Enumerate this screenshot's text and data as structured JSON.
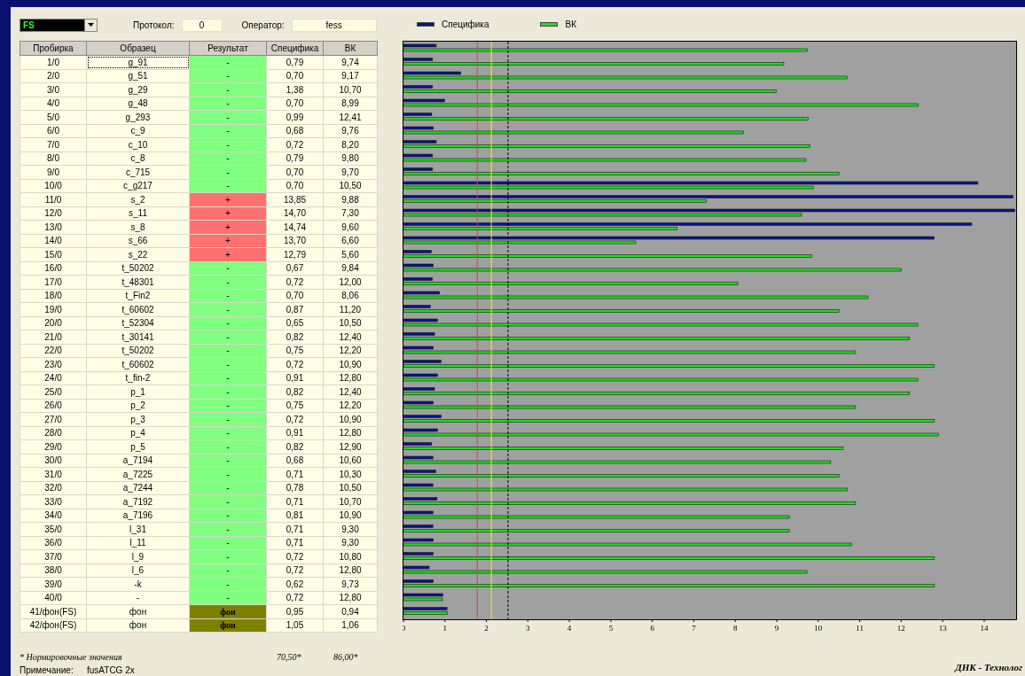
{
  "toolbar": {
    "selector": {
      "value": "FS"
    },
    "protocol": {
      "label": "Протокол:",
      "value": "0"
    },
    "operator": {
      "label": "Оператор:",
      "value": "fess"
    }
  },
  "table": {
    "columns": [
      "Пробирка",
      "Образец",
      "Результат",
      "Специфика",
      "ВК"
    ],
    "rows": [
      {
        "tube": "1/0",
        "sample": "g_91",
        "result": "-",
        "kind": "negative",
        "spec": "0,79",
        "vk": "9,74",
        "focused": true
      },
      {
        "tube": "2/0",
        "sample": "g_51",
        "result": "-",
        "kind": "negative",
        "spec": "0,70",
        "vk": "9,17",
        "focused": false
      },
      {
        "tube": "3/0",
        "sample": "g_29",
        "result": "-",
        "kind": "negative",
        "spec": "1,38",
        "vk": "10,70",
        "focused": false
      },
      {
        "tube": "4/0",
        "sample": "g_48",
        "result": "-",
        "kind": "negative",
        "spec": "0,70",
        "vk": "8,99",
        "focused": false
      },
      {
        "tube": "5/0",
        "sample": "g_293",
        "result": "-",
        "kind": "negative",
        "spec": "0,99",
        "vk": "12,41",
        "focused": false
      },
      {
        "tube": "6/0",
        "sample": "c_9",
        "result": "-",
        "kind": "negative",
        "spec": "0,68",
        "vk": "9,76",
        "focused": false
      },
      {
        "tube": "7/0",
        "sample": "c_10",
        "result": "-",
        "kind": "negative",
        "spec": "0,72",
        "vk": "8,20",
        "focused": false
      },
      {
        "tube": "8/0",
        "sample": "c_8",
        "result": "-",
        "kind": "negative",
        "spec": "0,79",
        "vk": "9,80",
        "focused": false
      },
      {
        "tube": "9/0",
        "sample": "c_715",
        "result": "-",
        "kind": "negative",
        "spec": "0,70",
        "vk": "9,70",
        "focused": false
      },
      {
        "tube": "10/0",
        "sample": "c_g217",
        "result": "-",
        "kind": "negative",
        "spec": "0,70",
        "vk": "10,50",
        "focused": false
      },
      {
        "tube": "11/0",
        "sample": "s_2",
        "result": "+",
        "kind": "positive",
        "spec": "13,85",
        "vk": "9,88",
        "focused": false
      },
      {
        "tube": "12/0",
        "sample": "s_11",
        "result": "+",
        "kind": "positive",
        "spec": "14,70",
        "vk": "7,30",
        "focused": false
      },
      {
        "tube": "13/0",
        "sample": "s_8",
        "result": "+",
        "kind": "positive",
        "spec": "14,74",
        "vk": "9,60",
        "focused": false
      },
      {
        "tube": "14/0",
        "sample": "s_66",
        "result": "+",
        "kind": "positive",
        "spec": "13,70",
        "vk": "6,60",
        "focused": false
      },
      {
        "tube": "15/0",
        "sample": "s_22",
        "result": "+",
        "kind": "positive",
        "spec": "12,79",
        "vk": "5,60",
        "focused": false
      },
      {
        "tube": "16/0",
        "sample": "t_50202",
        "result": "-",
        "kind": "negative",
        "spec": "0,67",
        "vk": "9,84",
        "focused": false
      },
      {
        "tube": "17/0",
        "sample": "t_48301",
        "result": "-",
        "kind": "negative",
        "spec": "0,72",
        "vk": "12,00",
        "focused": false
      },
      {
        "tube": "18/0",
        "sample": "t_Fin2",
        "result": "-",
        "kind": "negative",
        "spec": "0,70",
        "vk": "8,06",
        "focused": false
      },
      {
        "tube": "19/0",
        "sample": "t_60602",
        "result": "-",
        "kind": "negative",
        "spec": "0,87",
        "vk": "11,20",
        "focused": false
      },
      {
        "tube": "20/0",
        "sample": "t_52304",
        "result": "-",
        "kind": "negative",
        "spec": "0,65",
        "vk": "10,50",
        "focused": false
      },
      {
        "tube": "21/0",
        "sample": "t_30141",
        "result": "-",
        "kind": "negative",
        "spec": "0,82",
        "vk": "12,40",
        "focused": false
      },
      {
        "tube": "22/0",
        "sample": "t_50202",
        "result": "-",
        "kind": "negative",
        "spec": "0,75",
        "vk": "12,20",
        "focused": false
      },
      {
        "tube": "23/0",
        "sample": "t_60602",
        "result": "-",
        "kind": "negative",
        "spec": "0,72",
        "vk": "10,90",
        "focused": false
      },
      {
        "tube": "24/0",
        "sample": "t_fin-2",
        "result": "-",
        "kind": "negative",
        "spec": "0,91",
        "vk": "12,80",
        "focused": false
      },
      {
        "tube": "25/0",
        "sample": "p_1",
        "result": "-",
        "kind": "negative",
        "spec": "0,82",
        "vk": "12,40",
        "focused": false
      },
      {
        "tube": "26/0",
        "sample": "p_2",
        "result": "-",
        "kind": "negative",
        "spec": "0,75",
        "vk": "12,20",
        "focused": false
      },
      {
        "tube": "27/0",
        "sample": "p_3",
        "result": "-",
        "kind": "negative",
        "spec": "0,72",
        "vk": "10,90",
        "focused": false
      },
      {
        "tube": "28/0",
        "sample": "p_4",
        "result": "-",
        "kind": "negative",
        "spec": "0,91",
        "vk": "12,80",
        "focused": false
      },
      {
        "tube": "29/0",
        "sample": "p_5",
        "result": "-",
        "kind": "negative",
        "spec": "0,82",
        "vk": "12,90",
        "focused": false
      },
      {
        "tube": "30/0",
        "sample": "a_7194",
        "result": "-",
        "kind": "negative",
        "spec": "0,68",
        "vk": "10,60",
        "focused": false
      },
      {
        "tube": "31/0",
        "sample": "a_7225",
        "result": "-",
        "kind": "negative",
        "spec": "0,71",
        "vk": "10,30",
        "focused": false
      },
      {
        "tube": "32/0",
        "sample": "a_7244",
        "result": "-",
        "kind": "negative",
        "spec": "0,78",
        "vk": "10,50",
        "focused": false
      },
      {
        "tube": "33/0",
        "sample": "a_7192",
        "result": "-",
        "kind": "negative",
        "spec": "0,71",
        "vk": "10,70",
        "focused": false
      },
      {
        "tube": "34/0",
        "sample": "a_7196",
        "result": "-",
        "kind": "negative",
        "spec": "0,81",
        "vk": "10,90",
        "focused": false
      },
      {
        "tube": "35/0",
        "sample": "l_31",
        "result": "-",
        "kind": "negative",
        "spec": "0,71",
        "vk": "9,30",
        "focused": false
      },
      {
        "tube": "36/0",
        "sample": "l_11",
        "result": "-",
        "kind": "negative",
        "spec": "0,71",
        "vk": "9,30",
        "focused": false
      },
      {
        "tube": "37/0",
        "sample": "l_9",
        "result": "-",
        "kind": "negative",
        "spec": "0,72",
        "vk": "10,80",
        "focused": false
      },
      {
        "tube": "38/0",
        "sample": "l_6",
        "result": "-",
        "kind": "negative",
        "spec": "0,72",
        "vk": "12,80",
        "focused": false
      },
      {
        "tube": "39/0",
        "sample": "-k",
        "result": "-",
        "kind": "negative",
        "spec": "0,62",
        "vk": "9,73",
        "focused": false
      },
      {
        "tube": "40/0",
        "sample": "-",
        "result": "-",
        "kind": "negative",
        "spec": "0,72",
        "vk": "12,80",
        "focused": false
      },
      {
        "tube": "41/фон(FS)",
        "sample": "фон",
        "result": "фон",
        "kind": "background",
        "spec": "0,95",
        "vk": "0,94",
        "focused": false
      },
      {
        "tube": "42/фон(FS)",
        "sample": "фон",
        "result": "фон",
        "kind": "background",
        "spec": "1,05",
        "vk": "1,06",
        "focused": false
      }
    ]
  },
  "footnote": {
    "text": "* Нормировочные значения",
    "spec": "70,50*",
    "vk": "86,00*"
  },
  "note": {
    "label": "Примечание:",
    "value": "fusATCG 2x"
  },
  "brand": "ДНК - Технолог",
  "chart": {
    "chart_data": {
      "type": "bar",
      "orientation": "horizontal",
      "xlim": [
        0,
        14.75
      ],
      "xticks": [
        0,
        1,
        2,
        3,
        4,
        5,
        6,
        7,
        8,
        9,
        10,
        11,
        12,
        13,
        14
      ],
      "series": [
        {
          "name": "Специфика",
          "color": "#0a148c",
          "values": [
            0.79,
            0.7,
            1.38,
            0.7,
            0.99,
            0.68,
            0.72,
            0.79,
            0.7,
            0.7,
            13.85,
            14.7,
            14.74,
            13.7,
            12.79,
            0.67,
            0.72,
            0.7,
            0.87,
            0.65,
            0.82,
            0.75,
            0.72,
            0.91,
            0.82,
            0.75,
            0.72,
            0.91,
            0.82,
            0.68,
            0.71,
            0.78,
            0.71,
            0.81,
            0.71,
            0.71,
            0.72,
            0.72,
            0.62,
            0.72,
            0.95,
            1.05
          ]
        },
        {
          "name": "ВК",
          "color": "#22dd22",
          "values": [
            9.74,
            9.17,
            10.7,
            8.99,
            12.41,
            9.76,
            8.2,
            9.8,
            9.7,
            10.5,
            9.88,
            7.3,
            9.6,
            6.6,
            5.6,
            9.84,
            12.0,
            8.06,
            11.2,
            10.5,
            12.4,
            12.2,
            10.9,
            12.8,
            12.4,
            12.2,
            10.9,
            12.8,
            12.9,
            10.6,
            10.3,
            10.5,
            10.7,
            10.9,
            9.3,
            9.3,
            10.8,
            12.8,
            9.73,
            12.8,
            0.94,
            1.06
          ]
        }
      ],
      "ref_lines": [
        {
          "axis": "x",
          "value": 1.78
        },
        {
          "axis": "x",
          "value": 2.12
        },
        {
          "axis": "x",
          "value": 2.52
        }
      ]
    }
  }
}
